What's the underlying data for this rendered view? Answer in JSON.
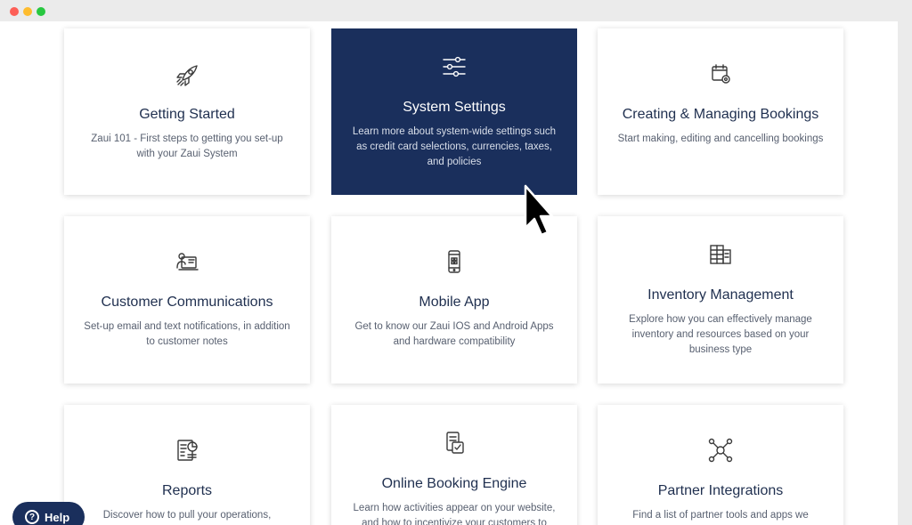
{
  "help": {
    "label": "Help",
    "icon": "question-circle-icon"
  },
  "cards": [
    {
      "title": "Getting Started",
      "desc": "Zaui 101 - First steps to getting you set-up with your Zaui System",
      "icon": "rocket-icon"
    },
    {
      "title": "System Settings",
      "desc": "Learn more about system-wide settings such as credit card selections, currencies, taxes, and policies",
      "icon": "sliders-icon",
      "active": true
    },
    {
      "title": "Creating & Managing Bookings",
      "desc": "Start making, editing and cancelling bookings",
      "icon": "calendar-gear-icon"
    },
    {
      "title": "Customer Communications",
      "desc": "Set-up email and text notifications, in addition to customer notes",
      "icon": "communications-icon"
    },
    {
      "title": "Mobile App",
      "desc": "Get to know our Zaui IOS and Android Apps and hardware compatibility",
      "icon": "mobile-phone-icon"
    },
    {
      "title": "Inventory Management",
      "desc": "Explore how you can effectively manage inventory and resources based on your business type",
      "icon": "inventory-icon"
    },
    {
      "title": "Reports",
      "desc": "Discover how to pull your operations,",
      "icon": "report-icon"
    },
    {
      "title": "Online Booking Engine",
      "desc": "Learn how activities appear on your website, and how to incentivize your customers to",
      "icon": "booking-engine-icon"
    },
    {
      "title": "Partner Integrations",
      "desc": "Find a list of partner tools and apps we",
      "icon": "integrations-icon"
    }
  ],
  "colors": {
    "accent": "#1a2f5c",
    "title_text": "#1f2f4f",
    "body_text": "#586070"
  }
}
